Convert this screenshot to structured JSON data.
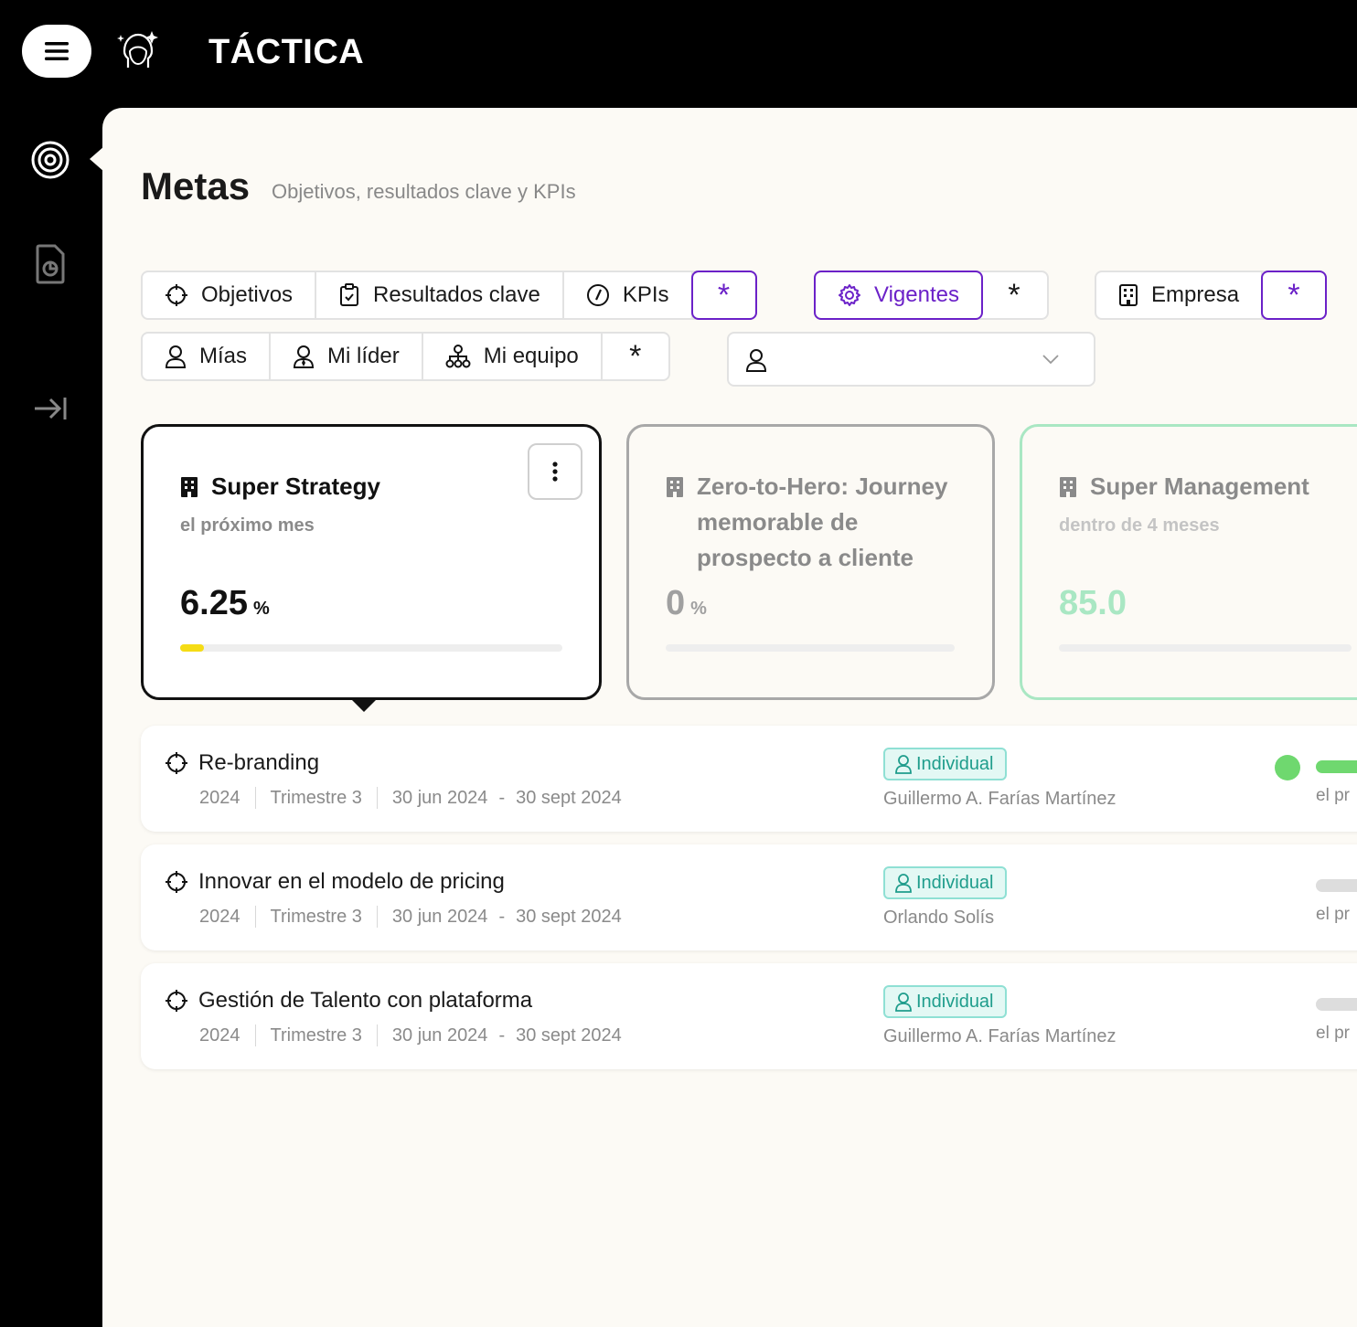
{
  "app": {
    "title": "TÁCTICA"
  },
  "header": {
    "title": "Metas",
    "subtitle": "Objetivos, resultados clave y KPIs"
  },
  "filters": {
    "type": [
      "Objetivos",
      "Resultados clave",
      "KPIs"
    ],
    "status": [
      "Vigentes"
    ],
    "scope": [
      "Empresa"
    ],
    "ownership": [
      "Mías",
      "Mi líder",
      "Mi equipo"
    ],
    "all_label": "*",
    "person_select_value": ""
  },
  "goals": [
    {
      "name": "Super Strategy",
      "due": "el próximo mes",
      "value": "6.25",
      "unit": "%",
      "progress": 0.0625,
      "selected": true
    },
    {
      "name": "Zero-to-Hero: Journey memorable de prospecto a cliente",
      "due": "",
      "value": "0",
      "unit": "%",
      "progress": 0
    },
    {
      "name": "Super Management",
      "due": "dentro de 4 meses",
      "value": "85.0",
      "unit": "",
      "progress": 0
    }
  ],
  "objectives": [
    {
      "title": "Re-branding",
      "year": "2024",
      "period": "Trimestre 3",
      "start": "30 jun 2024",
      "end": "30 sept 2024",
      "badge": "Individual",
      "owner": "Guillermo A. Farías Martínez",
      "due": "el pr"
    },
    {
      "title": "Innovar en el modelo de pricing",
      "year": "2024",
      "period": "Trimestre 3",
      "start": "30 jun 2024",
      "end": "30 sept 2024",
      "badge": "Individual",
      "owner": "Orlando Solís",
      "due": "el pr"
    },
    {
      "title": "Gestión de Talento con plataforma",
      "year": "2024",
      "period": "Trimestre 3",
      "start": "30 jun 2024",
      "end": "30 sept 2024",
      "badge": "Individual",
      "owner": "Guillermo A. Farías Martínez",
      "due": "el pr"
    }
  ],
  "colors": {
    "accent": "#6b21c8",
    "progress": "#f5dc15",
    "success": "#6fd86f",
    "badge": "#1f9d8c"
  }
}
